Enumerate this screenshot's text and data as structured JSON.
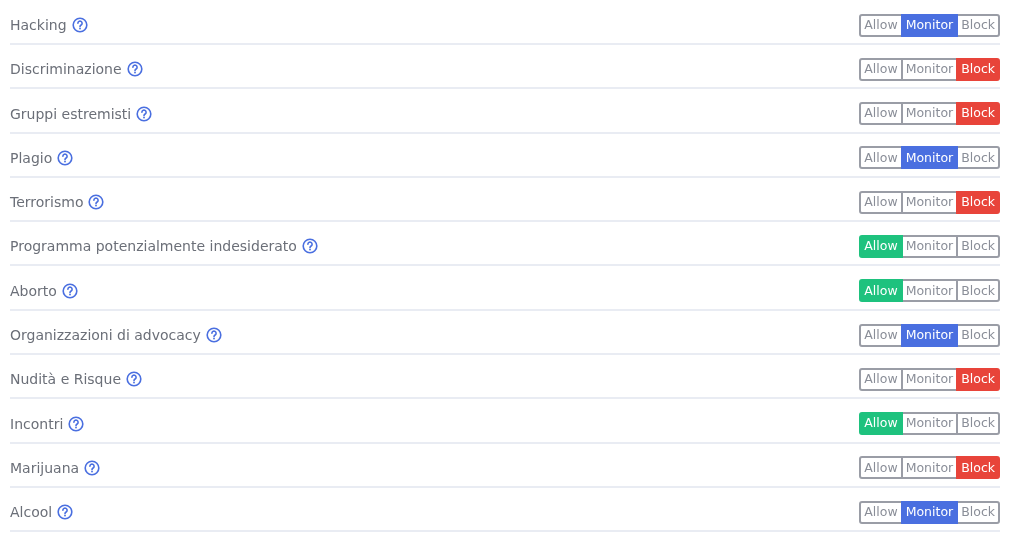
{
  "categories": [
    {
      "label": "Hacking",
      "options": [
        {
          "label": "Allow",
          "selected": false
        },
        {
          "label": "Monitor",
          "selected": true
        },
        {
          "label": "Block",
          "selected": false
        }
      ]
    },
    {
      "label": "Discriminazione",
      "options": [
        {
          "label": "Allow",
          "selected": false
        },
        {
          "label": "Monitor",
          "selected": false
        },
        {
          "label": "Block",
          "selected": true
        }
      ]
    },
    {
      "label": "Gruppi estremisti",
      "options": [
        {
          "label": "Allow",
          "selected": false
        },
        {
          "label": "Monitor",
          "selected": false
        },
        {
          "label": "Block",
          "selected": true
        }
      ]
    },
    {
      "label": "Plagio",
      "options": [
        {
          "label": "Allow",
          "selected": false
        },
        {
          "label": "Monitor",
          "selected": true
        },
        {
          "label": "Block",
          "selected": false
        }
      ]
    },
    {
      "label": "Terrorismo",
      "options": [
        {
          "label": "Allow",
          "selected": false
        },
        {
          "label": "Monitor",
          "selected": false
        },
        {
          "label": "Block",
          "selected": true
        }
      ]
    },
    {
      "label": "Programma potenzialmente indesiderato",
      "options": [
        {
          "label": "Allow",
          "selected": true
        },
        {
          "label": "Monitor",
          "selected": false
        },
        {
          "label": "Block",
          "selected": false
        }
      ]
    },
    {
      "label": "Aborto",
      "options": [
        {
          "label": "Allow",
          "selected": true
        },
        {
          "label": "Monitor",
          "selected": false
        },
        {
          "label": "Block",
          "selected": false
        }
      ]
    },
    {
      "label": "Organizzazioni di advocacy",
      "options": [
        {
          "label": "Allow",
          "selected": false
        },
        {
          "label": "Monitor",
          "selected": true
        },
        {
          "label": "Block",
          "selected": false
        }
      ]
    },
    {
      "label": "Nudità e Risque",
      "options": [
        {
          "label": "Allow",
          "selected": false
        },
        {
          "label": "Monitor",
          "selected": false
        },
        {
          "label": "Block",
          "selected": true
        }
      ]
    },
    {
      "label": "Incontri",
      "options": [
        {
          "label": "Allow",
          "selected": true
        },
        {
          "label": "Monitor",
          "selected": false
        },
        {
          "label": "Block",
          "selected": false
        }
      ]
    },
    {
      "label": "Marijuana",
      "options": [
        {
          "label": "Allow",
          "selected": false
        },
        {
          "label": "Monitor",
          "selected": false
        },
        {
          "label": "Block",
          "selected": true
        }
      ]
    },
    {
      "label": "Alcool",
      "options": [
        {
          "label": "Allow",
          "selected": false
        },
        {
          "label": "Monitor",
          "selected": true
        },
        {
          "label": "Block",
          "selected": false
        }
      ]
    }
  ]
}
